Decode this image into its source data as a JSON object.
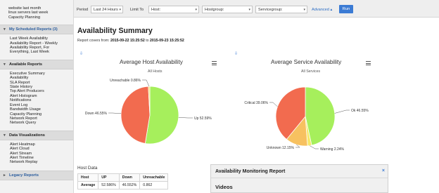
{
  "sidebar": {
    "top_links": [
      "website last month",
      "linux servers last week",
      "Capacity Planning"
    ],
    "scheduled": {
      "header": "My Scheduled Reports (3)",
      "items": [
        "Last Week Availability",
        "Availability Report - Weekly",
        "Availability Report, For",
        "Everything, Last Week"
      ]
    },
    "available": {
      "header": "Available Reports",
      "items": [
        "Executive Summary",
        "Availability",
        "SLA Report",
        "State History",
        "Top Alert Producers",
        "Alert Histogram",
        "Notifications",
        "Event Log",
        "Bandwidth Usage",
        "Capacity Planning",
        "Network Report",
        "Network Query"
      ]
    },
    "visualizations": {
      "header": "Data Visualizations",
      "items": [
        "Alert Heatmap",
        "Alert Cloud",
        "Alert Stream",
        "Alert Timeline",
        "Network Replay"
      ]
    },
    "legacy": {
      "header": "Legacy Reports"
    }
  },
  "toolbar": {
    "period_label": "Period",
    "period_value": "Last 24 Hours",
    "limit_label": "Limit To",
    "host_value": "Host:",
    "hostgroup_value": "Hostgroup:",
    "servicegroup_value": "Servicegroup:",
    "advanced_label": "Advanced",
    "run_label": "Run"
  },
  "main": {
    "title": "Availability Summary",
    "range_prefix": "Report covers from:",
    "range_start": "2015-09-22 15:25:52",
    "range_to": "to",
    "range_end": "2015-09-23 15:25:52"
  },
  "host_chart": {
    "title": "Average Host Availability",
    "subtitle": "All Hosts"
  },
  "service_chart": {
    "title": "Average Service Availability",
    "subtitle": "All Services"
  },
  "chart_data": [
    {
      "type": "pie",
      "title": "Average Host Availability",
      "subtitle": "All Hosts",
      "slices": [
        {
          "label": "Up",
          "value": 52.59,
          "display": "Up 52.59%",
          "color": "#a6ef5c"
        },
        {
          "label": "Down",
          "value": 46.55,
          "display": "Down 46.55%",
          "color": "#f26b4f"
        },
        {
          "label": "Unreachable",
          "value": 0.86,
          "display": "Unreachable 0.86%",
          "color": "#f0e060"
        }
      ]
    },
    {
      "type": "pie",
      "title": "Average Service Availability",
      "subtitle": "All Services",
      "slices": [
        {
          "label": "Ok",
          "value": 46.55,
          "display": "Ok 46.55%",
          "color": "#a6ef5c"
        },
        {
          "label": "Warning",
          "value": 2.24,
          "display": "Warning 2.24%",
          "color": "#f7e86a"
        },
        {
          "label": "Unknown",
          "value": 12.15,
          "display": "Unknown 12.15%",
          "color": "#f7c160"
        },
        {
          "label": "Critical",
          "value": 39.06,
          "display": "Critical 39.06%",
          "color": "#f26b4f"
        }
      ]
    }
  ],
  "host_data": {
    "title": "Host Data",
    "headers": [
      "Host",
      "UP",
      "Down",
      "Unreachable"
    ],
    "rows": [
      [
        "Average",
        "52.586%",
        "46.552%",
        "0.862"
      ]
    ]
  },
  "popup": {
    "title": "Availability Monitoring Report",
    "close": "×",
    "subtitle": "Videos"
  }
}
